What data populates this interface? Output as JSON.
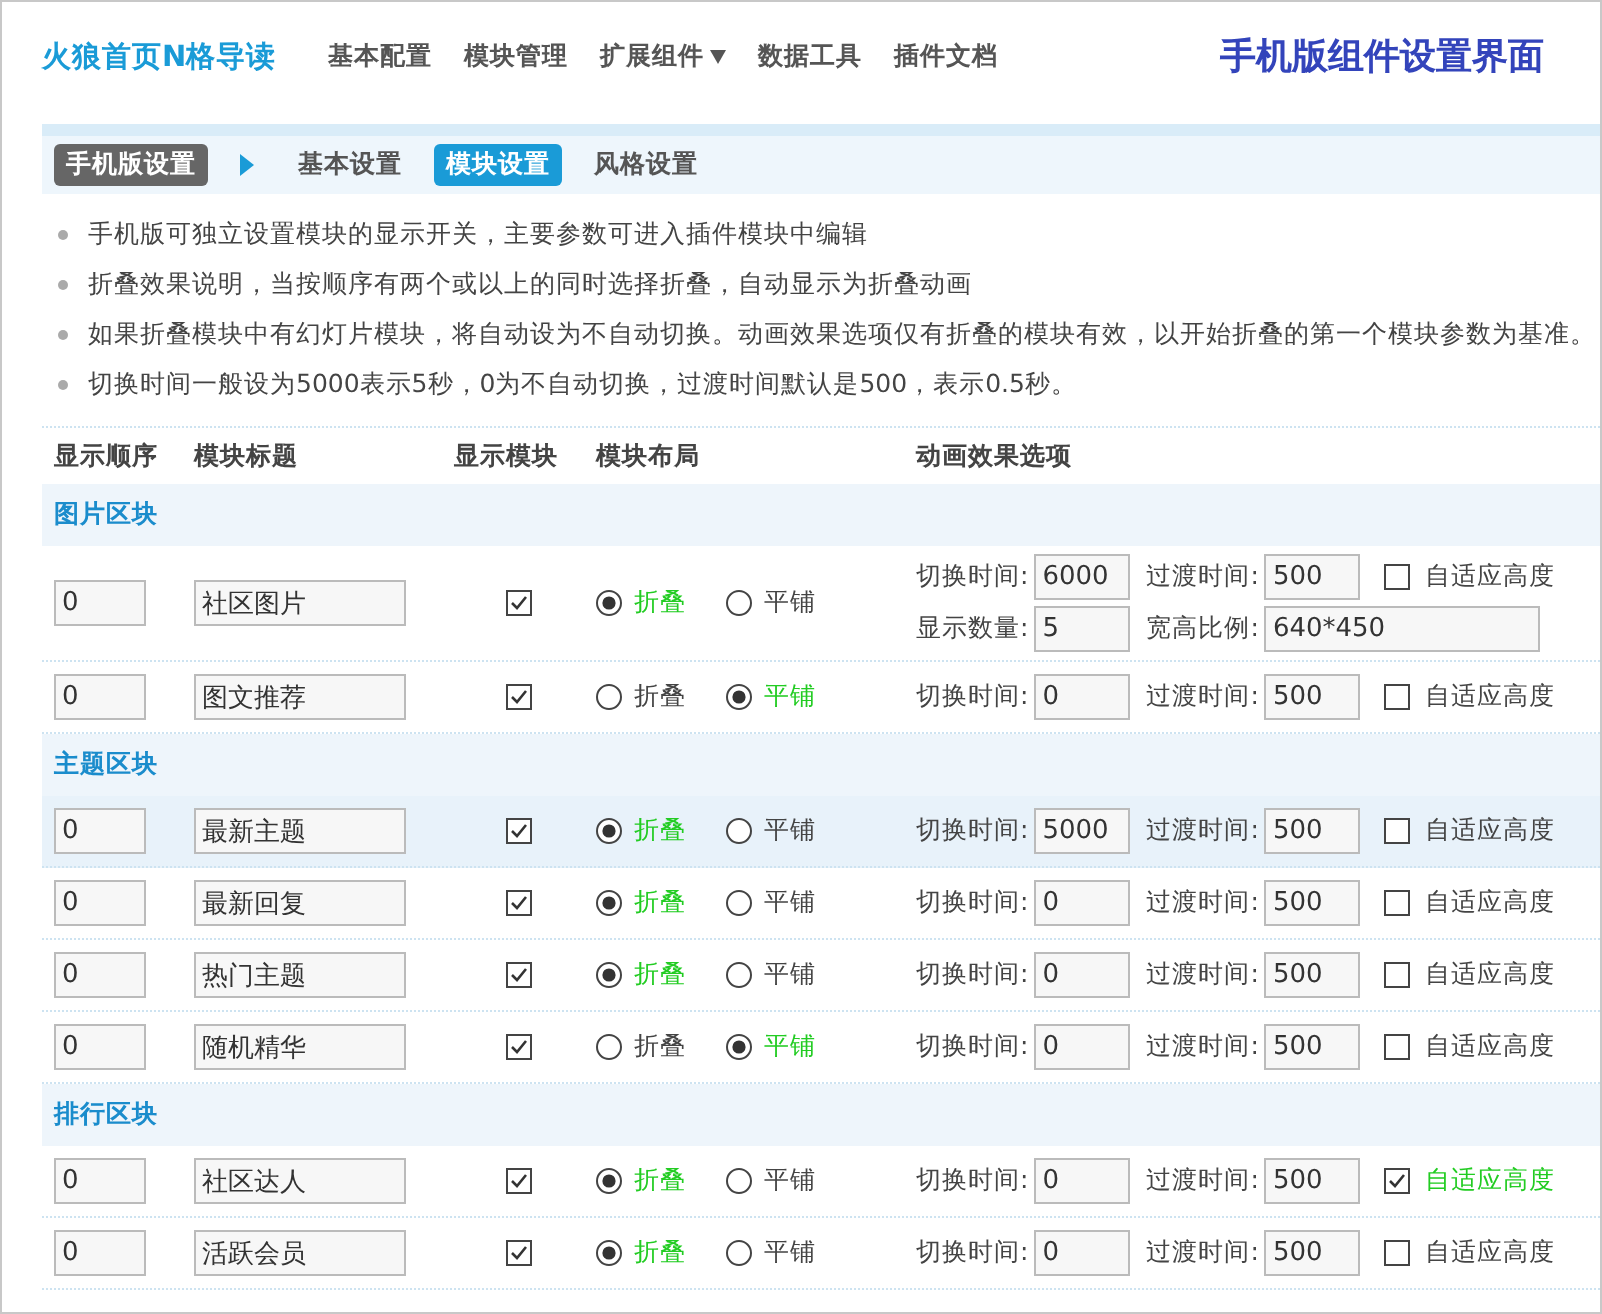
{
  "header": {
    "logo": "火狼首页N格导读",
    "nav": [
      {
        "label": "基本配置",
        "dropdown": false
      },
      {
        "label": "模块管理",
        "dropdown": false
      },
      {
        "label": "扩展组件",
        "dropdown": true
      },
      {
        "label": "数据工具",
        "dropdown": false
      },
      {
        "label": "插件文档",
        "dropdown": false
      }
    ],
    "title": "手机版组件设置界面"
  },
  "subnav": {
    "section": "手机版设置",
    "tabs": [
      {
        "label": "基本设置",
        "selected": false
      },
      {
        "label": "模块设置",
        "selected": true
      },
      {
        "label": "风格设置",
        "selected": false
      }
    ]
  },
  "notes": [
    "手机版可独立设置模块的显示开关，主要参数可进入插件模块中编辑",
    "折叠效果说明，当按顺序有两个或以上的同时选择折叠，自动显示为折叠动画",
    "如果折叠模块中有幻灯片模块，将自动设为不自动切换。动画效果选项仅有折叠的模块有效，以开始折叠的第一个模块参数为基准。",
    "切换时间一般设为5000表示5秒，0为不自动切换，过渡时间默认是500，表示0.5秒。"
  ],
  "table": {
    "columns": [
      "显示顺序",
      "模块标题",
      "显示模块",
      "模块布局",
      "动画效果选项"
    ],
    "sections": [
      {
        "title": "图片区块",
        "rows": [
          {
            "order": "0",
            "title": "社区图片",
            "shown": true,
            "highlighted": false,
            "layout": [
              {
                "label": "折叠",
                "selected": true
              },
              {
                "label": "平铺",
                "selected": false
              }
            ],
            "fields": [
              {
                "label": "切换时间:",
                "value": "6000"
              },
              {
                "label": "过渡时间:",
                "value": "500"
              }
            ],
            "auto_height": {
              "label": "自适应高度",
              "checked": false
            },
            "extra_fields": [
              {
                "label": "显示数量:",
                "value": "5"
              },
              {
                "label": "宽高比例:",
                "value": "640*450"
              }
            ]
          },
          {
            "order": "0",
            "title": "图文推荐",
            "shown": true,
            "highlighted": false,
            "layout": [
              {
                "label": "折叠",
                "selected": false
              },
              {
                "label": "平铺",
                "selected": true
              }
            ],
            "fields": [
              {
                "label": "切换时间:",
                "value": "0"
              },
              {
                "label": "过渡时间:",
                "value": "500"
              }
            ],
            "auto_height": {
              "label": "自适应高度",
              "checked": false
            }
          }
        ]
      },
      {
        "title": "主题区块",
        "rows": [
          {
            "order": "0",
            "title": "最新主题",
            "shown": true,
            "highlighted": true,
            "layout": [
              {
                "label": "折叠",
                "selected": true
              },
              {
                "label": "平铺",
                "selected": false
              }
            ],
            "fields": [
              {
                "label": "切换时间:",
                "value": "5000"
              },
              {
                "label": "过渡时间:",
                "value": "500"
              }
            ],
            "auto_height": {
              "label": "自适应高度",
              "checked": false
            }
          },
          {
            "order": "0",
            "title": "最新回复",
            "shown": true,
            "highlighted": false,
            "layout": [
              {
                "label": "折叠",
                "selected": true
              },
              {
                "label": "平铺",
                "selected": false
              }
            ],
            "fields": [
              {
                "label": "切换时间:",
                "value": "0"
              },
              {
                "label": "过渡时间:",
                "value": "500"
              }
            ],
            "auto_height": {
              "label": "自适应高度",
              "checked": false
            }
          },
          {
            "order": "0",
            "title": "热门主题",
            "shown": true,
            "highlighted": false,
            "layout": [
              {
                "label": "折叠",
                "selected": true
              },
              {
                "label": "平铺",
                "selected": false
              }
            ],
            "fields": [
              {
                "label": "切换时间:",
                "value": "0"
              },
              {
                "label": "过渡时间:",
                "value": "500"
              }
            ],
            "auto_height": {
              "label": "自适应高度",
              "checked": false
            }
          },
          {
            "order": "0",
            "title": "随机精华",
            "shown": true,
            "highlighted": false,
            "layout": [
              {
                "label": "折叠",
                "selected": false
              },
              {
                "label": "平铺",
                "selected": true
              }
            ],
            "fields": [
              {
                "label": "切换时间:",
                "value": "0"
              },
              {
                "label": "过渡时间:",
                "value": "500"
              }
            ],
            "auto_height": {
              "label": "自适应高度",
              "checked": false
            }
          }
        ]
      },
      {
        "title": "排行区块",
        "rows": [
          {
            "order": "0",
            "title": "社区达人",
            "shown": true,
            "highlighted": false,
            "layout": [
              {
                "label": "折叠",
                "selected": true
              },
              {
                "label": "平铺",
                "selected": false
              }
            ],
            "fields": [
              {
                "label": "切换时间:",
                "value": "0"
              },
              {
                "label": "过渡时间:",
                "value": "500"
              }
            ],
            "auto_height": {
              "label": "自适应高度",
              "checked": true
            }
          },
          {
            "order": "0",
            "title": "活跃会员",
            "shown": true,
            "highlighted": false,
            "layout": [
              {
                "label": "折叠",
                "selected": true
              },
              {
                "label": "平铺",
                "selected": false
              }
            ],
            "fields": [
              {
                "label": "切换时间:",
                "value": "0"
              },
              {
                "label": "过渡时间:",
                "value": "500"
              }
            ],
            "auto_height": {
              "label": "自适应高度",
              "checked": false
            }
          }
        ]
      }
    ]
  }
}
